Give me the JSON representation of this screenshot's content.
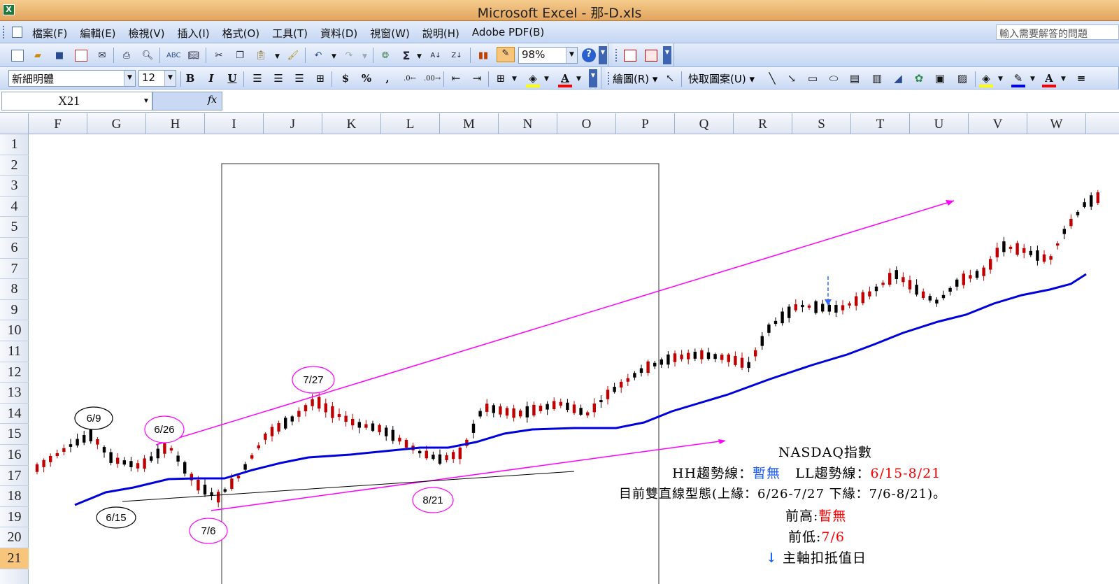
{
  "window": {
    "title": "Microsoft Excel - 那-D.xls",
    "app_icon": "excel-icon"
  },
  "menu": {
    "items": [
      "檔案(F)",
      "編輯(E)",
      "檢視(V)",
      "插入(I)",
      "格式(O)",
      "工具(T)",
      "資料(D)",
      "視窗(W)",
      "說明(H)",
      "Adobe PDF(B)"
    ],
    "help_placeholder": "輸入需要解答的問題"
  },
  "toolbar": {
    "sigma": "Σ",
    "zoom": "98%",
    "font_name": "新細明體",
    "font_size": "12",
    "bold": "B",
    "italic": "I",
    "underline": "U",
    "currency": "$",
    "percent": "%",
    "comma": ",",
    "draw_label": "繪圖(R)",
    "autoshape_label": "快取圖案(U)",
    "font_color_letter": "A",
    "colors": {
      "fill": "#ffff00",
      "font": "#ff0000",
      "line": "#0000ff"
    }
  },
  "formula_bar": {
    "name_box": "X21",
    "fx": "fx",
    "content": ""
  },
  "grid": {
    "columns": [
      "F",
      "G",
      "H",
      "I",
      "J",
      "K",
      "L",
      "M",
      "N",
      "O",
      "P",
      "Q",
      "R",
      "S",
      "T",
      "U",
      "V",
      "W"
    ],
    "rows": [
      "1",
      "2",
      "3",
      "4",
      "5",
      "6",
      "7",
      "8",
      "9",
      "10",
      "11",
      "12",
      "13",
      "14",
      "15",
      "16",
      "17",
      "18",
      "19",
      "20",
      "21"
    ],
    "selected_row": "21"
  },
  "chart_data": {
    "type": "candlestick",
    "title": "NASDAQ指數",
    "colors": {
      "up": "#c00000",
      "down": "#000000",
      "moving_average": "#0000dd",
      "trend_lines": "#ff00ff",
      "support_line": "#000000"
    },
    "annotations": [
      "6/9",
      "6/15",
      "6/26",
      "7/6",
      "7/27",
      "8/21"
    ],
    "notes": {
      "hh_label": "HH趨勢線：",
      "hh_value": "暫無",
      "ll_label": "LL趨勢線：",
      "ll_value": "6/15-8/21",
      "pattern": "目前雙直線型態(上緣：6/26-7/27 下緣：7/6-8/21)。",
      "prev_high_label": "前高:",
      "prev_high_value": "暫無",
      "prev_low_label": "前低:",
      "prev_low_value": "7/6",
      "arrow_glyph": "↓",
      "axis_note": "主軸扣抵值日"
    }
  }
}
